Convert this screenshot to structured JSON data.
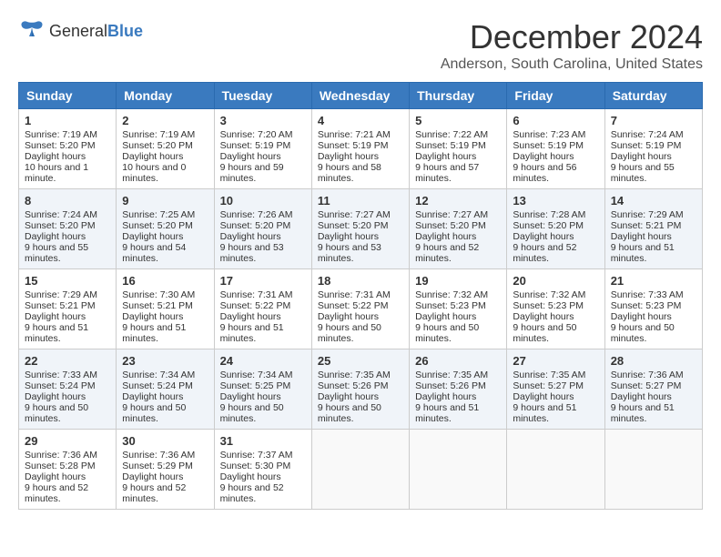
{
  "header": {
    "logo_general": "General",
    "logo_blue": "Blue",
    "month_title": "December 2024",
    "location": "Anderson, South Carolina, United States"
  },
  "days_of_week": [
    "Sunday",
    "Monday",
    "Tuesday",
    "Wednesday",
    "Thursday",
    "Friday",
    "Saturday"
  ],
  "weeks": [
    [
      {
        "day": "1",
        "sunrise": "7:19 AM",
        "sunset": "5:20 PM",
        "daylight": "10 hours and 1 minute."
      },
      {
        "day": "2",
        "sunrise": "7:19 AM",
        "sunset": "5:20 PM",
        "daylight": "10 hours and 0 minutes."
      },
      {
        "day": "3",
        "sunrise": "7:20 AM",
        "sunset": "5:19 PM",
        "daylight": "9 hours and 59 minutes."
      },
      {
        "day": "4",
        "sunrise": "7:21 AM",
        "sunset": "5:19 PM",
        "daylight": "9 hours and 58 minutes."
      },
      {
        "day": "5",
        "sunrise": "7:22 AM",
        "sunset": "5:19 PM",
        "daylight": "9 hours and 57 minutes."
      },
      {
        "day": "6",
        "sunrise": "7:23 AM",
        "sunset": "5:19 PM",
        "daylight": "9 hours and 56 minutes."
      },
      {
        "day": "7",
        "sunrise": "7:24 AM",
        "sunset": "5:19 PM",
        "daylight": "9 hours and 55 minutes."
      }
    ],
    [
      {
        "day": "8",
        "sunrise": "7:24 AM",
        "sunset": "5:20 PM",
        "daylight": "9 hours and 55 minutes."
      },
      {
        "day": "9",
        "sunrise": "7:25 AM",
        "sunset": "5:20 PM",
        "daylight": "9 hours and 54 minutes."
      },
      {
        "day": "10",
        "sunrise": "7:26 AM",
        "sunset": "5:20 PM",
        "daylight": "9 hours and 53 minutes."
      },
      {
        "day": "11",
        "sunrise": "7:27 AM",
        "sunset": "5:20 PM",
        "daylight": "9 hours and 53 minutes."
      },
      {
        "day": "12",
        "sunrise": "7:27 AM",
        "sunset": "5:20 PM",
        "daylight": "9 hours and 52 minutes."
      },
      {
        "day": "13",
        "sunrise": "7:28 AM",
        "sunset": "5:20 PM",
        "daylight": "9 hours and 52 minutes."
      },
      {
        "day": "14",
        "sunrise": "7:29 AM",
        "sunset": "5:21 PM",
        "daylight": "9 hours and 51 minutes."
      }
    ],
    [
      {
        "day": "15",
        "sunrise": "7:29 AM",
        "sunset": "5:21 PM",
        "daylight": "9 hours and 51 minutes."
      },
      {
        "day": "16",
        "sunrise": "7:30 AM",
        "sunset": "5:21 PM",
        "daylight": "9 hours and 51 minutes."
      },
      {
        "day": "17",
        "sunrise": "7:31 AM",
        "sunset": "5:22 PM",
        "daylight": "9 hours and 51 minutes."
      },
      {
        "day": "18",
        "sunrise": "7:31 AM",
        "sunset": "5:22 PM",
        "daylight": "9 hours and 50 minutes."
      },
      {
        "day": "19",
        "sunrise": "7:32 AM",
        "sunset": "5:23 PM",
        "daylight": "9 hours and 50 minutes."
      },
      {
        "day": "20",
        "sunrise": "7:32 AM",
        "sunset": "5:23 PM",
        "daylight": "9 hours and 50 minutes."
      },
      {
        "day": "21",
        "sunrise": "7:33 AM",
        "sunset": "5:23 PM",
        "daylight": "9 hours and 50 minutes."
      }
    ],
    [
      {
        "day": "22",
        "sunrise": "7:33 AM",
        "sunset": "5:24 PM",
        "daylight": "9 hours and 50 minutes."
      },
      {
        "day": "23",
        "sunrise": "7:34 AM",
        "sunset": "5:24 PM",
        "daylight": "9 hours and 50 minutes."
      },
      {
        "day": "24",
        "sunrise": "7:34 AM",
        "sunset": "5:25 PM",
        "daylight": "9 hours and 50 minutes."
      },
      {
        "day": "25",
        "sunrise": "7:35 AM",
        "sunset": "5:26 PM",
        "daylight": "9 hours and 50 minutes."
      },
      {
        "day": "26",
        "sunrise": "7:35 AM",
        "sunset": "5:26 PM",
        "daylight": "9 hours and 51 minutes."
      },
      {
        "day": "27",
        "sunrise": "7:35 AM",
        "sunset": "5:27 PM",
        "daylight": "9 hours and 51 minutes."
      },
      {
        "day": "28",
        "sunrise": "7:36 AM",
        "sunset": "5:27 PM",
        "daylight": "9 hours and 51 minutes."
      }
    ],
    [
      {
        "day": "29",
        "sunrise": "7:36 AM",
        "sunset": "5:28 PM",
        "daylight": "9 hours and 52 minutes."
      },
      {
        "day": "30",
        "sunrise": "7:36 AM",
        "sunset": "5:29 PM",
        "daylight": "9 hours and 52 minutes."
      },
      {
        "day": "31",
        "sunrise": "7:37 AM",
        "sunset": "5:30 PM",
        "daylight": "9 hours and 52 minutes."
      },
      null,
      null,
      null,
      null
    ]
  ],
  "labels": {
    "sunrise": "Sunrise:",
    "sunset": "Sunset:",
    "daylight": "Daylight hours"
  }
}
